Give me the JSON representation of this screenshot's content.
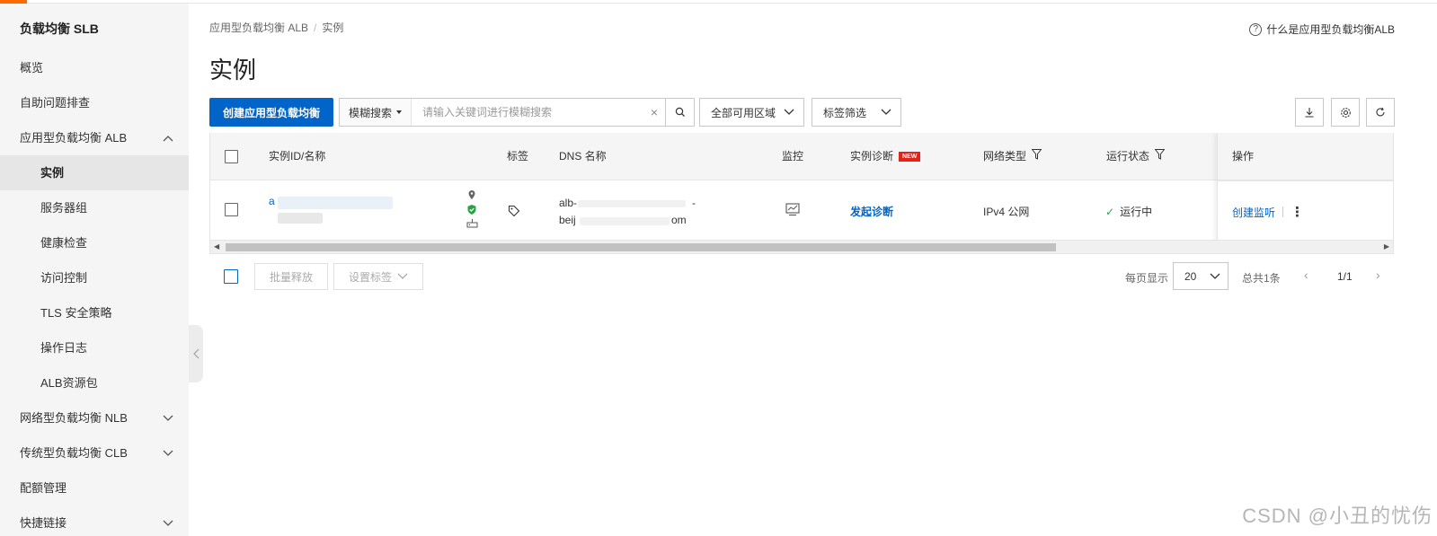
{
  "colors": {
    "accent": "#ff6a00",
    "primary": "#0064c8",
    "badge": "#e2231a",
    "success": "#2aa544"
  },
  "sidebar": {
    "title": "负载均衡 SLB",
    "items": [
      {
        "label": "概览"
      },
      {
        "label": "自助问题排查"
      },
      {
        "label": "应用型负载均衡 ALB",
        "expanded": true
      },
      {
        "label": "实例",
        "active": true
      },
      {
        "label": "服务器组"
      },
      {
        "label": "健康检查"
      },
      {
        "label": "访问控制"
      },
      {
        "label": "TLS 安全策略"
      },
      {
        "label": "操作日志"
      },
      {
        "label": "ALB资源包"
      },
      {
        "label": "网络型负载均衡 NLB",
        "expanded": false
      },
      {
        "label": "传统型负载均衡 CLB",
        "expanded": false
      },
      {
        "label": "配额管理"
      },
      {
        "label": "快捷链接",
        "expanded": false
      }
    ]
  },
  "breadcrumb": {
    "parent": "应用型负载均衡 ALB",
    "separator": "/",
    "current": "实例"
  },
  "help": {
    "icon": "?",
    "label": "什么是应用型负载均衡ALB"
  },
  "page_title": "实例",
  "toolbar": {
    "create_label": "创建应用型负载均衡",
    "search_type": "模糊搜索",
    "search_placeholder": "请输入关键词进行模糊搜索",
    "search_clear": "×",
    "region_filter": "全部可用区域",
    "tag_filter": "标签筛选",
    "icons": [
      "download-icon",
      "settings-icon",
      "refresh-icon"
    ]
  },
  "table": {
    "columns": {
      "id": "实例ID/名称",
      "tags": "标签",
      "dns": "DNS 名称",
      "monitor": "监控",
      "diagnosis": "实例诊断",
      "new_badge": "NEW",
      "network": "网络类型",
      "status": "运行状态",
      "ops": "操作"
    },
    "rows": [
      {
        "id_prefix": "a",
        "dns_line1": "alb-",
        "dns_line1_end": "-",
        "dns_line2_start": "beij",
        "dns_line2_end": "om",
        "diagnosis": "发起诊断",
        "network": "IPv4 公网",
        "status_icon": "✓",
        "status": "运行中",
        "op_create_listener": "创建监听",
        "op_more": "⋮"
      }
    ]
  },
  "footer": {
    "batch_release": "批量释放",
    "set_tags": "设置标签",
    "per_page_label": "每页显示",
    "per_page": "20",
    "total": "总共1条",
    "page": "1/1",
    "prev": "‹",
    "next": "›"
  },
  "watermark": "CSDN @小丑的忧伤"
}
